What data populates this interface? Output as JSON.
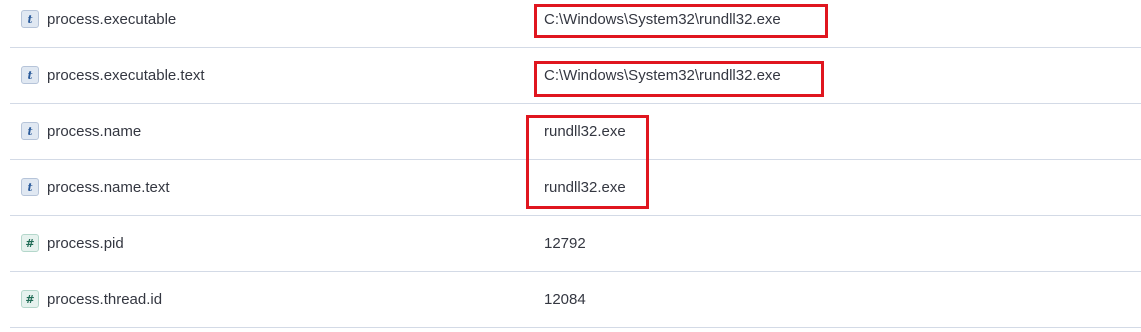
{
  "rows": [
    {
      "type_icon": "t",
      "field": "process.executable",
      "value": "C:\\Windows\\System32\\rundll32.exe"
    },
    {
      "type_icon": "t",
      "field": "process.executable.text",
      "value": "C:\\Windows\\System32\\rundll32.exe"
    },
    {
      "type_icon": "t",
      "field": "process.name",
      "value": "rundll32.exe"
    },
    {
      "type_icon": "t",
      "field": "process.name.text",
      "value": "rundll32.exe"
    },
    {
      "type_icon": "#",
      "field": "process.pid",
      "value": "12792"
    },
    {
      "type_icon": "#",
      "field": "process.thread.id",
      "value": "12084"
    }
  ],
  "colors": {
    "highlight": "#e0161f",
    "divider": "#d3dae6",
    "text": "#343741"
  }
}
